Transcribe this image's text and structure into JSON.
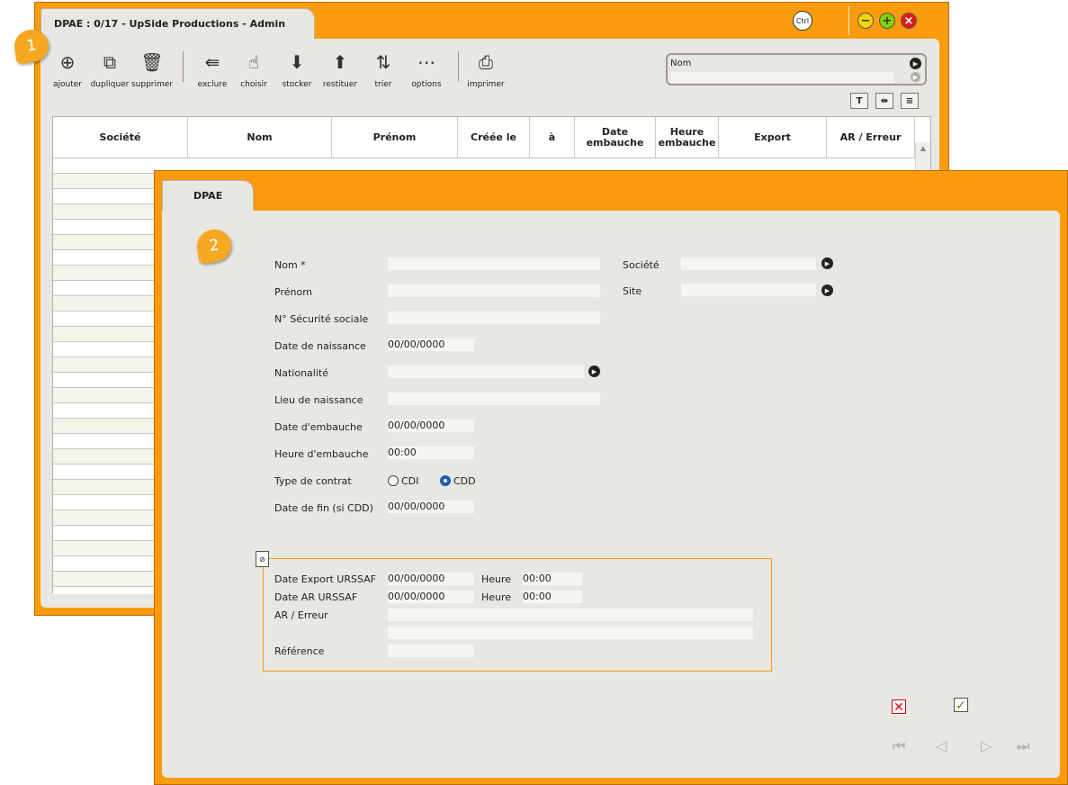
{
  "back_window": {
    "title": "DPAE : 0/17 - UpSide Productions - Admin",
    "ctrl_label": "Ctrl",
    "toolbar": [
      {
        "name": "ajouter",
        "label": "ajouter",
        "icon": "add-circle-icon"
      },
      {
        "name": "dupliquer",
        "label": "dupliquer",
        "icon": "duplicate-icon"
      },
      {
        "name": "supprimer",
        "label": "supprimer",
        "icon": "trash-icon"
      },
      {
        "name": "exclure",
        "label": "exclure",
        "icon": "exclude-icon"
      },
      {
        "name": "choisir",
        "label": "choisir",
        "icon": "choose-hand-icon"
      },
      {
        "name": "stocker",
        "label": "stocker",
        "icon": "store-box-icon"
      },
      {
        "name": "restituer",
        "label": "restituer",
        "icon": "restore-box-icon"
      },
      {
        "name": "trier",
        "label": "trier",
        "icon": "sort-az-icon"
      },
      {
        "name": "options",
        "label": "options",
        "icon": "options-icon"
      },
      {
        "name": "imprimer",
        "label": "imprimer",
        "icon": "printer-icon"
      }
    ],
    "search": {
      "label": "Nom",
      "value": ""
    },
    "columns": [
      "Société",
      "Nom",
      "Prénom",
      "Créée le",
      "à",
      "Date embauche",
      "Heure embauche",
      "Export",
      "AR / Erreur"
    ]
  },
  "badges": {
    "first": "1",
    "second": "2"
  },
  "front_window": {
    "tab": "DPAE",
    "form": {
      "nom": {
        "label": "Nom *",
        "value": ""
      },
      "prenom": {
        "label": "Prénom",
        "value": ""
      },
      "secu": {
        "label": "N° Sécurité sociale",
        "value": ""
      },
      "naissance": {
        "label": "Date de naissance",
        "value": "00/00/0000"
      },
      "nationalite": {
        "label": "Nationalité",
        "value": ""
      },
      "lieu": {
        "label": "Lieu de naissance",
        "value": ""
      },
      "embauche": {
        "label": "Date d'embauche",
        "value": "00/00/0000"
      },
      "heure": {
        "label": "Heure d'embauche",
        "value": "00:00"
      },
      "contrat": {
        "label": "Type de contrat",
        "options": [
          "CDI",
          "CDD"
        ],
        "selected": "CDD"
      },
      "fin": {
        "label": "Date de fin (si CDD)",
        "value": "00/00/0000"
      },
      "societe": {
        "label": "Société",
        "value": ""
      },
      "site": {
        "label": "Site",
        "value": ""
      }
    },
    "urssaf": {
      "export_label": "Date Export URSSAF",
      "export_date": "00/00/0000",
      "ar_label": "Date AR URSSAF",
      "ar_date": "00/00/0000",
      "heure_label": "Heure",
      "export_time": "00:00",
      "ar_time": "00:00",
      "erreur_label": "AR / Erreur",
      "reference_label": "Référence"
    }
  }
}
